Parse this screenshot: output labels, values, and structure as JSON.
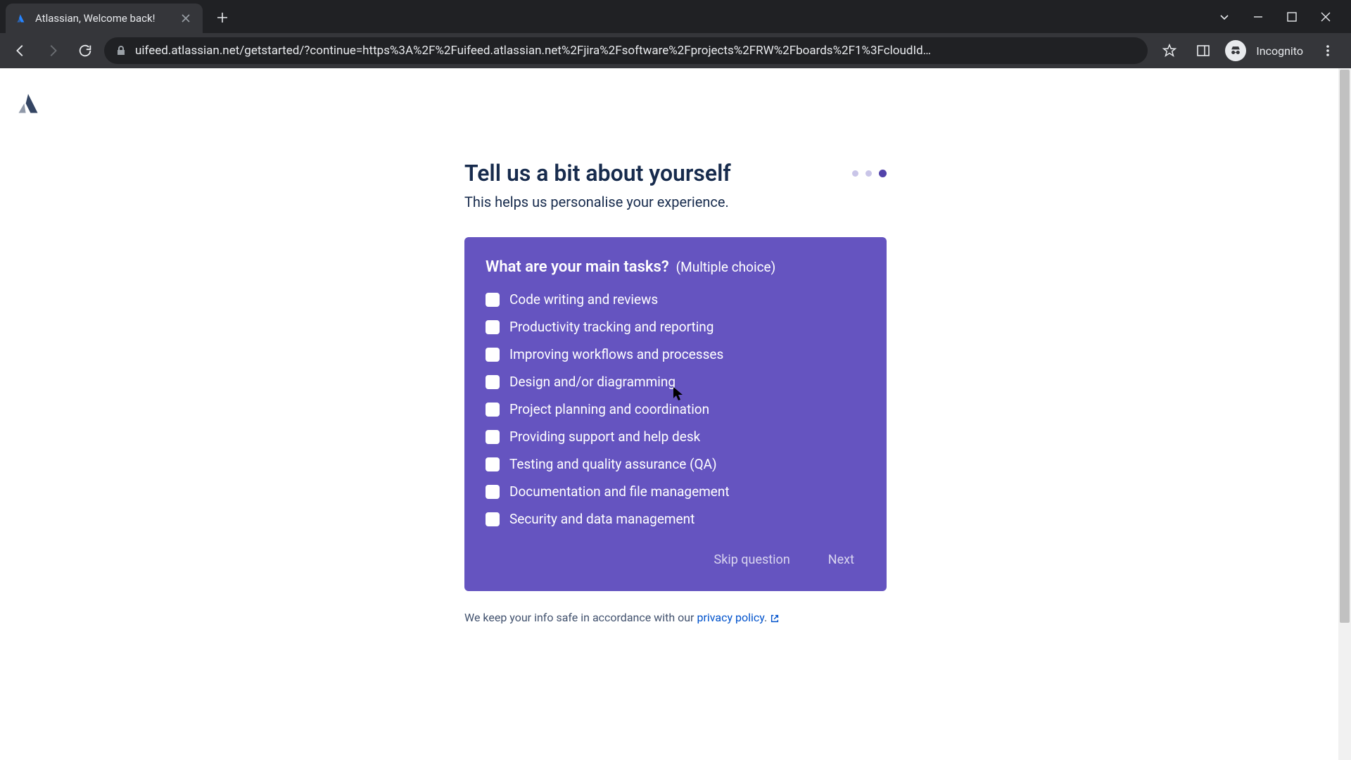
{
  "browser": {
    "tab_title": "Atlassian, Welcome back!",
    "url": "uifeed.atlassian.net/getstarted/?continue=https%3A%2F%2Fuifeed.atlassian.net%2Fjira%2Fsoftware%2Fprojects%2FRW%2Fboards%2F1%3FcloudId…",
    "incognito_label": "Incognito"
  },
  "page": {
    "heading": "Tell us a bit about yourself",
    "subheading": "This helps us personalise your experience.",
    "progress": {
      "total": 3,
      "current": 3
    }
  },
  "card": {
    "question": "What are your main tasks?",
    "hint": "(Multiple choice)",
    "options": [
      "Code writing and reviews",
      "Productivity tracking and reporting",
      "Improving workflows and processes",
      "Design and/or diagramming",
      "Project planning and coordination",
      "Providing support and help desk",
      "Testing and quality assurance (QA)",
      "Documentation and file management",
      "Security and data management"
    ],
    "skip_label": "Skip question",
    "next_label": "Next"
  },
  "privacy": {
    "prefix": "We keep your info safe in accordance with our ",
    "link_text": "privacy policy"
  }
}
